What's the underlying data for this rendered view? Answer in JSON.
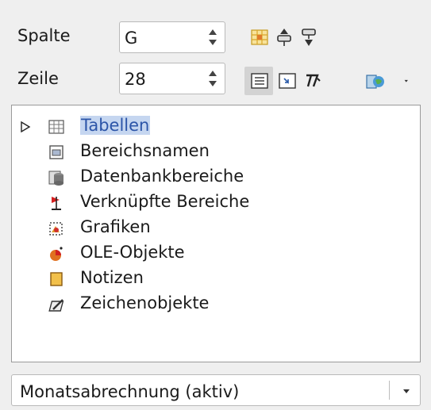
{
  "labels": {
    "column": "Spalte",
    "row": "Zeile"
  },
  "fields": {
    "column_value": "G",
    "row_value": "28"
  },
  "toolbar": {
    "row1": [
      "data-range-icon",
      "start-icon",
      "end-icon"
    ],
    "row2": [
      "contents-toggle-icon",
      "toggle-icon",
      "scenarios-icon",
      "drag-mode-icon",
      "dropdown-arrow-icon"
    ]
  },
  "tree": {
    "items": [
      {
        "label": "Tabellen",
        "icon": "tables-icon",
        "selected": true
      },
      {
        "label": "Bereichsnamen",
        "icon": "range-names-icon"
      },
      {
        "label": "Datenbankbereiche",
        "icon": "database-ranges-icon"
      },
      {
        "label": "Verknüpfte Bereiche",
        "icon": "linked-areas-icon"
      },
      {
        "label": "Grafiken",
        "icon": "images-icon"
      },
      {
        "label": "OLE-Objekte",
        "icon": "ole-objects-icon"
      },
      {
        "label": "Notizen",
        "icon": "comments-icon"
      },
      {
        "label": "Zeichenobjekte",
        "icon": "drawing-objects-icon"
      }
    ]
  },
  "document_select": {
    "value": "Monatsabrechnung (aktiv)"
  }
}
